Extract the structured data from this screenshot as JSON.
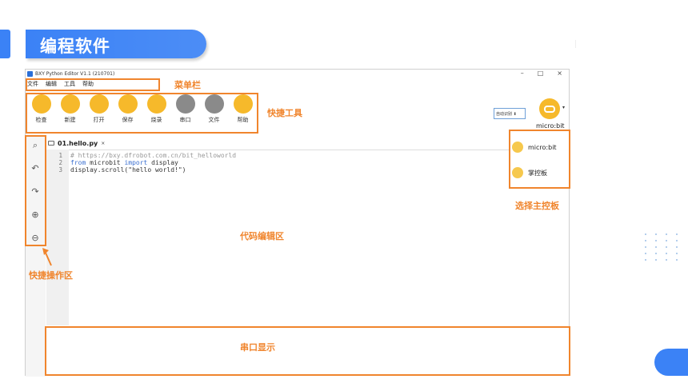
{
  "slide": {
    "title": "编程软件"
  },
  "window": {
    "title": "BXY Python Editor V1.1 (210701)",
    "controls": [
      "–",
      "□",
      "×"
    ]
  },
  "menubar": [
    "文件",
    "编辑",
    "工具",
    "帮助"
  ],
  "toolbar": [
    {
      "label": "检查",
      "icon": "thumbs-up-icon"
    },
    {
      "label": "新建",
      "icon": "new-file-icon"
    },
    {
      "label": "打开",
      "icon": "folder-open-icon"
    },
    {
      "label": "保存",
      "icon": "save-icon"
    },
    {
      "label": "烧录",
      "icon": "flash-upload-icon"
    },
    {
      "label": "串口",
      "icon": "serial-port-icon"
    },
    {
      "label": "文件",
      "icon": "file-manager-icon"
    },
    {
      "label": "帮助",
      "icon": "help-icon"
    }
  ],
  "board": {
    "selector": "自动识别 ⬇",
    "current": "micro:bit",
    "options": [
      "micro:bit",
      "掌控板"
    ]
  },
  "editor": {
    "tab": "01.hello.py",
    "tab_close": "×",
    "line_numbers": [
      "1",
      "2",
      "3"
    ],
    "lines": [
      [
        {
          "t": "# https://bxy.dfrobot.com.cn/bit_helloworld",
          "c": "cmt"
        }
      ],
      [
        {
          "t": "from",
          "c": "kw"
        },
        {
          "t": " microbit ",
          "c": ""
        },
        {
          "t": "import",
          "c": "kw"
        },
        {
          "t": " display",
          "c": ""
        }
      ],
      [
        {
          "t": "display.scroll(\"hello world!\")",
          "c": ""
        }
      ]
    ]
  },
  "quickbar": [
    {
      "icon": "search-icon",
      "glyph": "⌕"
    },
    {
      "icon": "undo-icon",
      "glyph": "↶"
    },
    {
      "icon": "redo-icon",
      "glyph": "↷"
    },
    {
      "icon": "zoom-in-icon",
      "glyph": "⊕"
    },
    {
      "icon": "zoom-out-icon",
      "glyph": "⊖"
    }
  ],
  "annotations": {
    "menubar": "菜单栏",
    "toolbar": "快捷工具",
    "board": "选择主控板",
    "editor": "代码编辑区",
    "quickbar": "快捷操作区",
    "serial": "串口显示"
  },
  "colors": {
    "accent": "#3b82f6",
    "annotation": "#f0852d",
    "tool_yellow": "#f6b92b",
    "tool_gray": "#8a8a8a"
  }
}
